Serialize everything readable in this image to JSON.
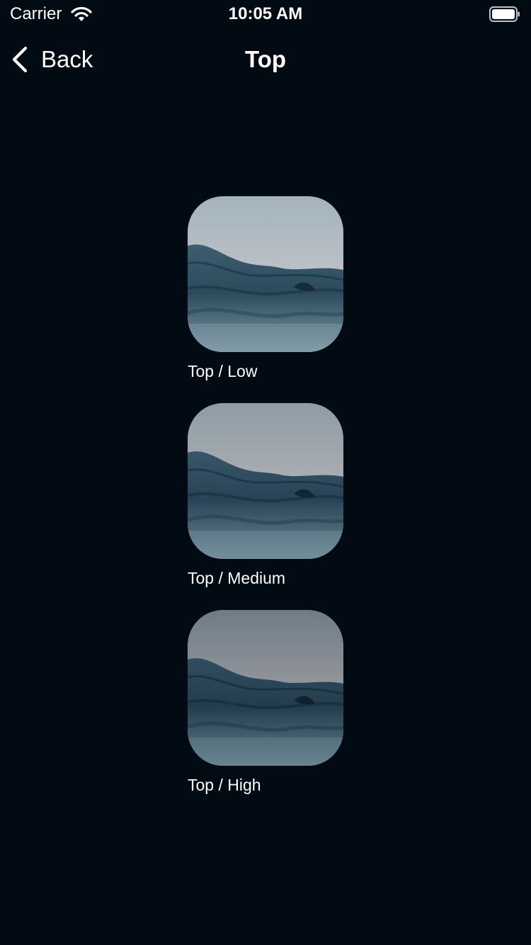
{
  "status_bar": {
    "carrier": "Carrier",
    "time": "10:05 AM",
    "wifi_icon": "wifi-icon",
    "battery_icon": "battery-icon"
  },
  "nav": {
    "back_label": "Back",
    "back_icon": "chevron-left-icon",
    "title": "Top"
  },
  "gallery": {
    "items": [
      {
        "caption": "Top / Low",
        "image": "ocean-wave-photo"
      },
      {
        "caption": "Top / Medium",
        "image": "ocean-wave-photo"
      },
      {
        "caption": "Top / High",
        "image": "ocean-wave-photo"
      }
    ]
  },
  "colors": {
    "background": "#020a14",
    "text": "#ffffff"
  }
}
